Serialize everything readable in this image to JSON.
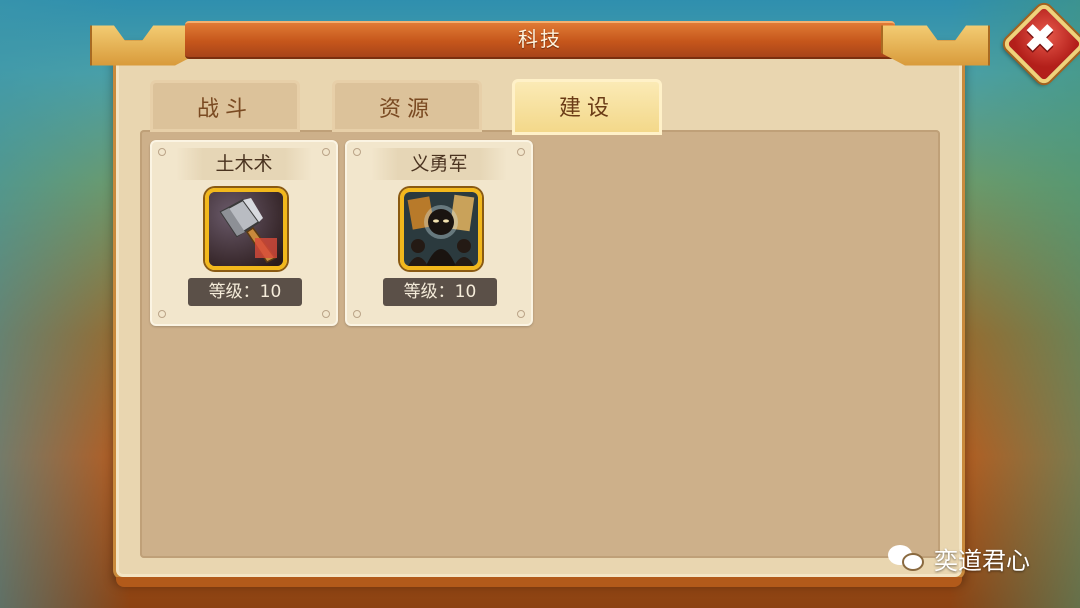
{
  "dialog": {
    "title": "科技"
  },
  "tabs": [
    {
      "label": "战斗",
      "active": false
    },
    {
      "label": "资源",
      "active": false
    },
    {
      "label": "建设",
      "active": true
    }
  ],
  "cards": [
    {
      "name": "土木术",
      "level_text": "等级：10",
      "icon": "hammer-icon"
    },
    {
      "name": "义勇军",
      "level_text": "等级：10",
      "icon": "militia-icon"
    }
  ],
  "close_button": {
    "icon": "close-icon",
    "glyph": "✖"
  },
  "watermark": {
    "text": "奕道君心",
    "icon": "wechat-icon"
  },
  "colors": {
    "title_band": "#c5561b",
    "panel": "#cdb08a",
    "active_tab": "#f3d88a",
    "close_red": "#b31f1a",
    "icon_frame": "#f2b81c",
    "level_badge": "#5b5048"
  }
}
